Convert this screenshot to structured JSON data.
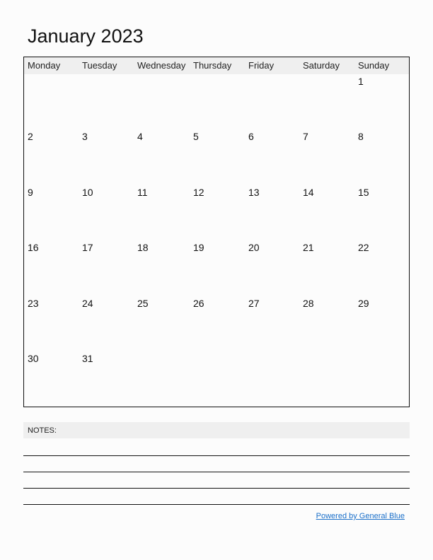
{
  "title": "January 2023",
  "weekdays": [
    "Monday",
    "Tuesday",
    "Wednesday",
    "Thursday",
    "Friday",
    "Saturday",
    "Sunday"
  ],
  "weeks": [
    [
      "",
      "",
      "",
      "",
      "",
      "",
      "1"
    ],
    [
      "2",
      "3",
      "4",
      "5",
      "6",
      "7",
      "8"
    ],
    [
      "9",
      "10",
      "11",
      "12",
      "13",
      "14",
      "15"
    ],
    [
      "16",
      "17",
      "18",
      "19",
      "20",
      "21",
      "22"
    ],
    [
      "23",
      "24",
      "25",
      "26",
      "27",
      "28",
      "29"
    ],
    [
      "30",
      "31",
      "",
      "",
      "",
      "",
      ""
    ]
  ],
  "notes": {
    "label": "NOTES:"
  },
  "footer": {
    "link_text": "Powered by General Blue"
  },
  "colors": {
    "link": "#1a6fc9",
    "header_bg": "#efefef"
  }
}
